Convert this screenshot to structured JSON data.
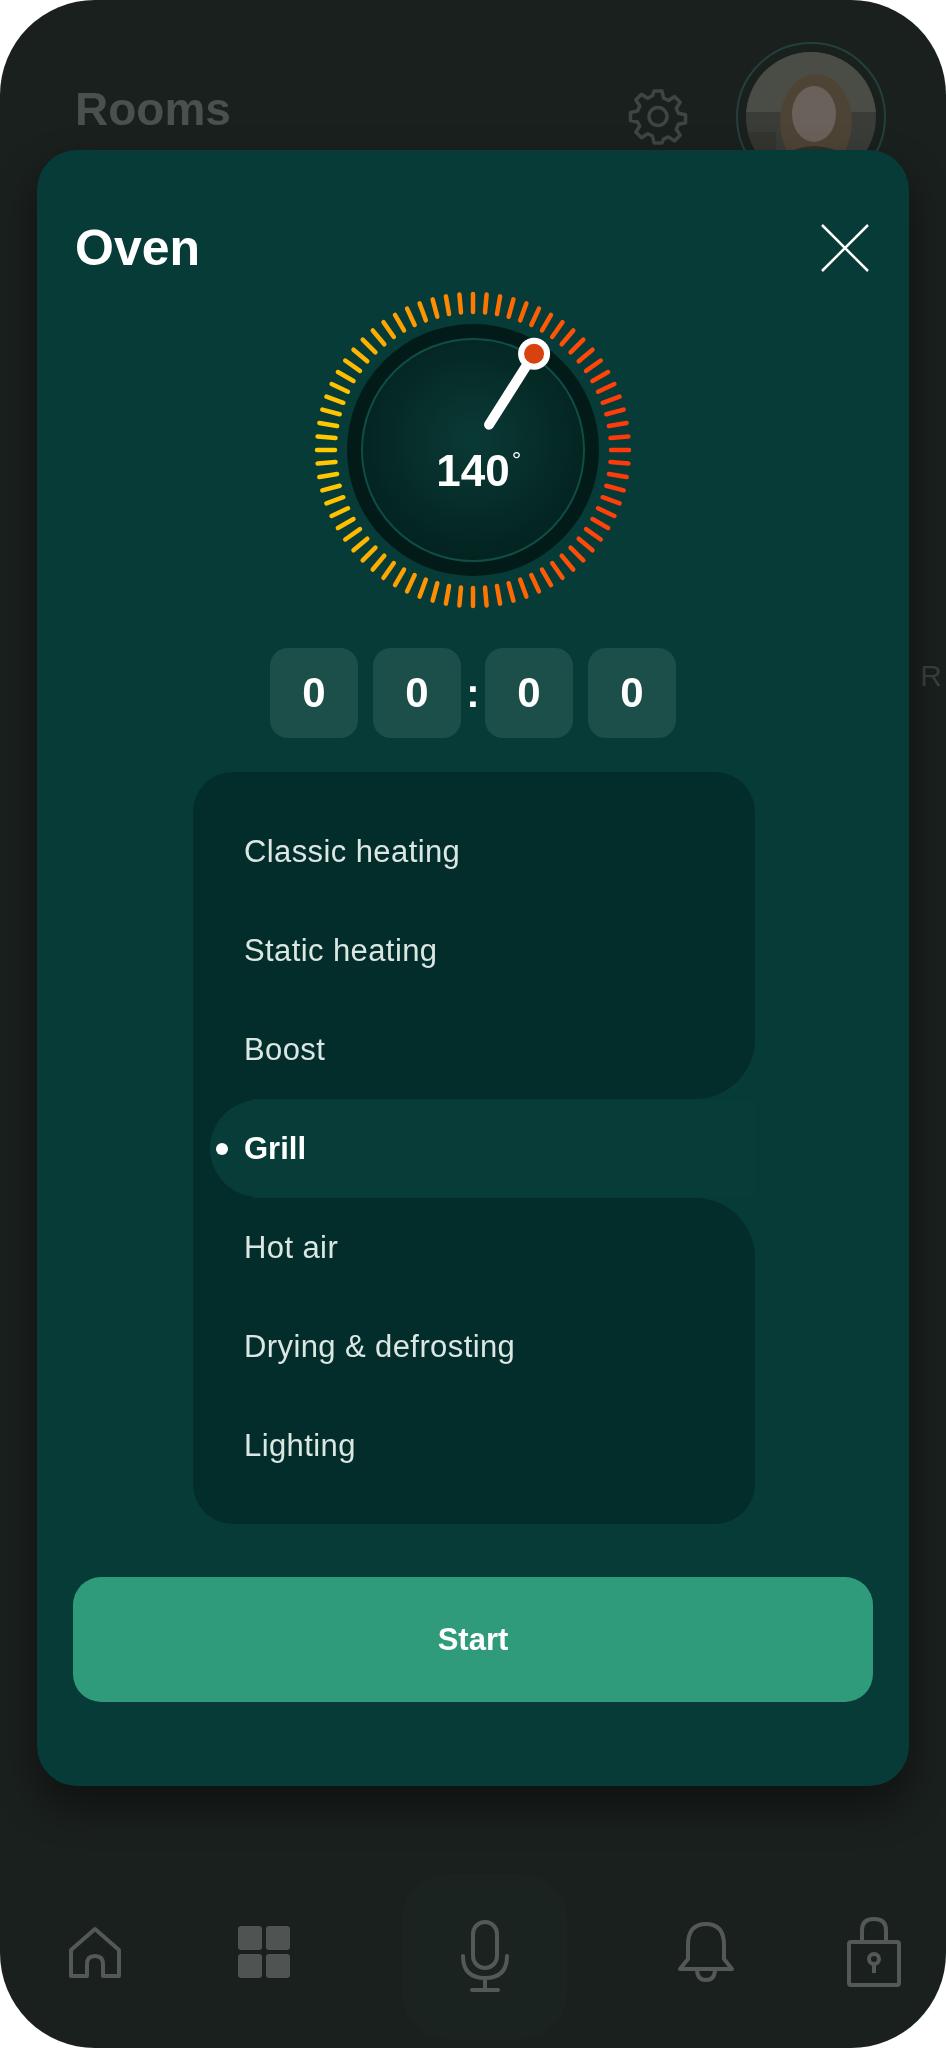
{
  "background": {
    "title": "Rooms",
    "side_text": "R"
  },
  "modal": {
    "title": "Oven",
    "dial": {
      "value": "140",
      "unit": "°"
    },
    "timer": {
      "digits": [
        "0",
        "0",
        "0",
        "0"
      ],
      "separator": ":"
    },
    "modes": [
      {
        "label": "Classic heating",
        "selected": false
      },
      {
        "label": "Static heating",
        "selected": false
      },
      {
        "label": "Boost",
        "selected": false
      },
      {
        "label": "Grill",
        "selected": true
      },
      {
        "label": "Hot air",
        "selected": false
      },
      {
        "label": "Drying & defrosting",
        "selected": false
      },
      {
        "label": "Lighting",
        "selected": false
      }
    ],
    "start_button": "Start"
  },
  "nav": [
    {
      "kind": "home"
    },
    {
      "kind": "grid"
    },
    {
      "kind": "mic"
    },
    {
      "kind": "bell"
    },
    {
      "kind": "lock"
    }
  ]
}
